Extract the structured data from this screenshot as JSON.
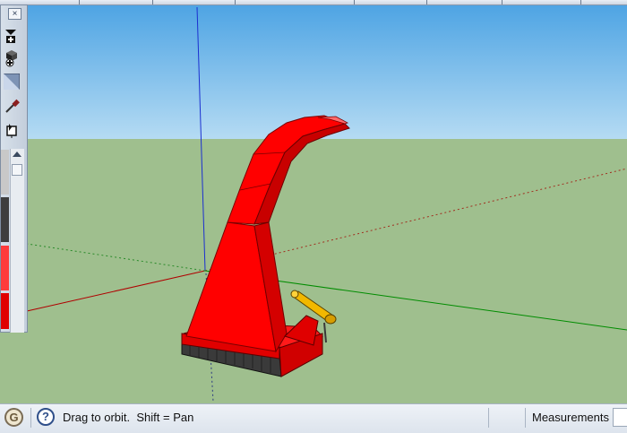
{
  "status_bar": {
    "hint": "Drag to orbit.  Shift = Pan",
    "measurements_label": "Measurements",
    "measurements_value": ""
  },
  "tool_panel": {
    "close_glyph": "×",
    "icons": [
      "add-layer-icon",
      "components-icon",
      "materials-icon",
      "eyedropper-icon",
      "paint-bucket-icon"
    ],
    "swatch_colors": [
      "#c8c8c8",
      "#8f8f8f",
      "#3e3e3e",
      "#ff3b3b",
      "#e00000"
    ]
  },
  "scene": {
    "sky_color": "#6bb7ea",
    "ground_color": "#9fbf8e",
    "model_color": "#ff0000",
    "axis_colors": {
      "red": "#c00000",
      "green": "#00a000",
      "blue": "#0000cc"
    }
  }
}
